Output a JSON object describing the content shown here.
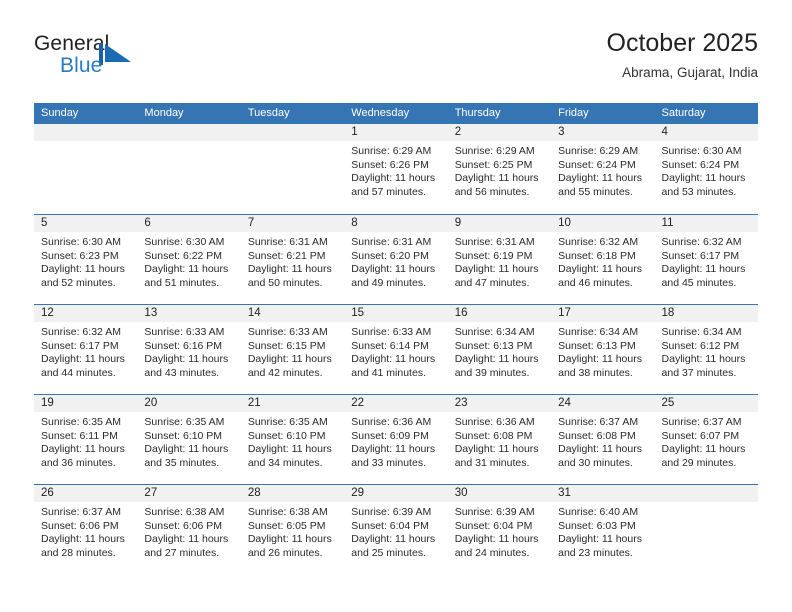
{
  "brand": {
    "name_top": "General",
    "name_bottom": "Blue",
    "mark_icon": "blue-triangle-flag-icon",
    "accent_color": "#2b7cc4"
  },
  "header": {
    "title": "October 2025",
    "subtitle": "Abrama, Gujarat, India"
  },
  "calendar": {
    "header_color": "#3575b4",
    "day_band_color": "#f1f1f1",
    "weekdays": [
      "Sunday",
      "Monday",
      "Tuesday",
      "Wednesday",
      "Thursday",
      "Friday",
      "Saturday"
    ],
    "weeks": [
      [
        {
          "day": "",
          "empty": true,
          "sunrise": "",
          "sunset": "",
          "daylight_line1": "",
          "daylight_line2": ""
        },
        {
          "day": "",
          "empty": true,
          "sunrise": "",
          "sunset": "",
          "daylight_line1": "",
          "daylight_line2": ""
        },
        {
          "day": "",
          "empty": true,
          "sunrise": "",
          "sunset": "",
          "daylight_line1": "",
          "daylight_line2": ""
        },
        {
          "day": "1",
          "empty": false,
          "sunrise": "Sunrise: 6:29 AM",
          "sunset": "Sunset: 6:26 PM",
          "daylight_line1": "Daylight: 11 hours",
          "daylight_line2": "and 57 minutes."
        },
        {
          "day": "2",
          "empty": false,
          "sunrise": "Sunrise: 6:29 AM",
          "sunset": "Sunset: 6:25 PM",
          "daylight_line1": "Daylight: 11 hours",
          "daylight_line2": "and 56 minutes."
        },
        {
          "day": "3",
          "empty": false,
          "sunrise": "Sunrise: 6:29 AM",
          "sunset": "Sunset: 6:24 PM",
          "daylight_line1": "Daylight: 11 hours",
          "daylight_line2": "and 55 minutes."
        },
        {
          "day": "4",
          "empty": false,
          "sunrise": "Sunrise: 6:30 AM",
          "sunset": "Sunset: 6:24 PM",
          "daylight_line1": "Daylight: 11 hours",
          "daylight_line2": "and 53 minutes."
        }
      ],
      [
        {
          "day": "5",
          "empty": false,
          "sunrise": "Sunrise: 6:30 AM",
          "sunset": "Sunset: 6:23 PM",
          "daylight_line1": "Daylight: 11 hours",
          "daylight_line2": "and 52 minutes."
        },
        {
          "day": "6",
          "empty": false,
          "sunrise": "Sunrise: 6:30 AM",
          "sunset": "Sunset: 6:22 PM",
          "daylight_line1": "Daylight: 11 hours",
          "daylight_line2": "and 51 minutes."
        },
        {
          "day": "7",
          "empty": false,
          "sunrise": "Sunrise: 6:31 AM",
          "sunset": "Sunset: 6:21 PM",
          "daylight_line1": "Daylight: 11 hours",
          "daylight_line2": "and 50 minutes."
        },
        {
          "day": "8",
          "empty": false,
          "sunrise": "Sunrise: 6:31 AM",
          "sunset": "Sunset: 6:20 PM",
          "daylight_line1": "Daylight: 11 hours",
          "daylight_line2": "and 49 minutes."
        },
        {
          "day": "9",
          "empty": false,
          "sunrise": "Sunrise: 6:31 AM",
          "sunset": "Sunset: 6:19 PM",
          "daylight_line1": "Daylight: 11 hours",
          "daylight_line2": "and 47 minutes."
        },
        {
          "day": "10",
          "empty": false,
          "sunrise": "Sunrise: 6:32 AM",
          "sunset": "Sunset: 6:18 PM",
          "daylight_line1": "Daylight: 11 hours",
          "daylight_line2": "and 46 minutes."
        },
        {
          "day": "11",
          "empty": false,
          "sunrise": "Sunrise: 6:32 AM",
          "sunset": "Sunset: 6:17 PM",
          "daylight_line1": "Daylight: 11 hours",
          "daylight_line2": "and 45 minutes."
        }
      ],
      [
        {
          "day": "12",
          "empty": false,
          "sunrise": "Sunrise: 6:32 AM",
          "sunset": "Sunset: 6:17 PM",
          "daylight_line1": "Daylight: 11 hours",
          "daylight_line2": "and 44 minutes."
        },
        {
          "day": "13",
          "empty": false,
          "sunrise": "Sunrise: 6:33 AM",
          "sunset": "Sunset: 6:16 PM",
          "daylight_line1": "Daylight: 11 hours",
          "daylight_line2": "and 43 minutes."
        },
        {
          "day": "14",
          "empty": false,
          "sunrise": "Sunrise: 6:33 AM",
          "sunset": "Sunset: 6:15 PM",
          "daylight_line1": "Daylight: 11 hours",
          "daylight_line2": "and 42 minutes."
        },
        {
          "day": "15",
          "empty": false,
          "sunrise": "Sunrise: 6:33 AM",
          "sunset": "Sunset: 6:14 PM",
          "daylight_line1": "Daylight: 11 hours",
          "daylight_line2": "and 41 minutes."
        },
        {
          "day": "16",
          "empty": false,
          "sunrise": "Sunrise: 6:34 AM",
          "sunset": "Sunset: 6:13 PM",
          "daylight_line1": "Daylight: 11 hours",
          "daylight_line2": "and 39 minutes."
        },
        {
          "day": "17",
          "empty": false,
          "sunrise": "Sunrise: 6:34 AM",
          "sunset": "Sunset: 6:13 PM",
          "daylight_line1": "Daylight: 11 hours",
          "daylight_line2": "and 38 minutes."
        },
        {
          "day": "18",
          "empty": false,
          "sunrise": "Sunrise: 6:34 AM",
          "sunset": "Sunset: 6:12 PM",
          "daylight_line1": "Daylight: 11 hours",
          "daylight_line2": "and 37 minutes."
        }
      ],
      [
        {
          "day": "19",
          "empty": false,
          "sunrise": "Sunrise: 6:35 AM",
          "sunset": "Sunset: 6:11 PM",
          "daylight_line1": "Daylight: 11 hours",
          "daylight_line2": "and 36 minutes."
        },
        {
          "day": "20",
          "empty": false,
          "sunrise": "Sunrise: 6:35 AM",
          "sunset": "Sunset: 6:10 PM",
          "daylight_line1": "Daylight: 11 hours",
          "daylight_line2": "and 35 minutes."
        },
        {
          "day": "21",
          "empty": false,
          "sunrise": "Sunrise: 6:35 AM",
          "sunset": "Sunset: 6:10 PM",
          "daylight_line1": "Daylight: 11 hours",
          "daylight_line2": "and 34 minutes."
        },
        {
          "day": "22",
          "empty": false,
          "sunrise": "Sunrise: 6:36 AM",
          "sunset": "Sunset: 6:09 PM",
          "daylight_line1": "Daylight: 11 hours",
          "daylight_line2": "and 33 minutes."
        },
        {
          "day": "23",
          "empty": false,
          "sunrise": "Sunrise: 6:36 AM",
          "sunset": "Sunset: 6:08 PM",
          "daylight_line1": "Daylight: 11 hours",
          "daylight_line2": "and 31 minutes."
        },
        {
          "day": "24",
          "empty": false,
          "sunrise": "Sunrise: 6:37 AM",
          "sunset": "Sunset: 6:08 PM",
          "daylight_line1": "Daylight: 11 hours",
          "daylight_line2": "and 30 minutes."
        },
        {
          "day": "25",
          "empty": false,
          "sunrise": "Sunrise: 6:37 AM",
          "sunset": "Sunset: 6:07 PM",
          "daylight_line1": "Daylight: 11 hours",
          "daylight_line2": "and 29 minutes."
        }
      ],
      [
        {
          "day": "26",
          "empty": false,
          "sunrise": "Sunrise: 6:37 AM",
          "sunset": "Sunset: 6:06 PM",
          "daylight_line1": "Daylight: 11 hours",
          "daylight_line2": "and 28 minutes."
        },
        {
          "day": "27",
          "empty": false,
          "sunrise": "Sunrise: 6:38 AM",
          "sunset": "Sunset: 6:06 PM",
          "daylight_line1": "Daylight: 11 hours",
          "daylight_line2": "and 27 minutes."
        },
        {
          "day": "28",
          "empty": false,
          "sunrise": "Sunrise: 6:38 AM",
          "sunset": "Sunset: 6:05 PM",
          "daylight_line1": "Daylight: 11 hours",
          "daylight_line2": "and 26 minutes."
        },
        {
          "day": "29",
          "empty": false,
          "sunrise": "Sunrise: 6:39 AM",
          "sunset": "Sunset: 6:04 PM",
          "daylight_line1": "Daylight: 11 hours",
          "daylight_line2": "and 25 minutes."
        },
        {
          "day": "30",
          "empty": false,
          "sunrise": "Sunrise: 6:39 AM",
          "sunset": "Sunset: 6:04 PM",
          "daylight_line1": "Daylight: 11 hours",
          "daylight_line2": "and 24 minutes."
        },
        {
          "day": "31",
          "empty": false,
          "sunrise": "Sunrise: 6:40 AM",
          "sunset": "Sunset: 6:03 PM",
          "daylight_line1": "Daylight: 11 hours",
          "daylight_line2": "and 23 minutes."
        },
        {
          "day": "",
          "empty": true,
          "sunrise": "",
          "sunset": "",
          "daylight_line1": "",
          "daylight_line2": ""
        }
      ]
    ]
  }
}
